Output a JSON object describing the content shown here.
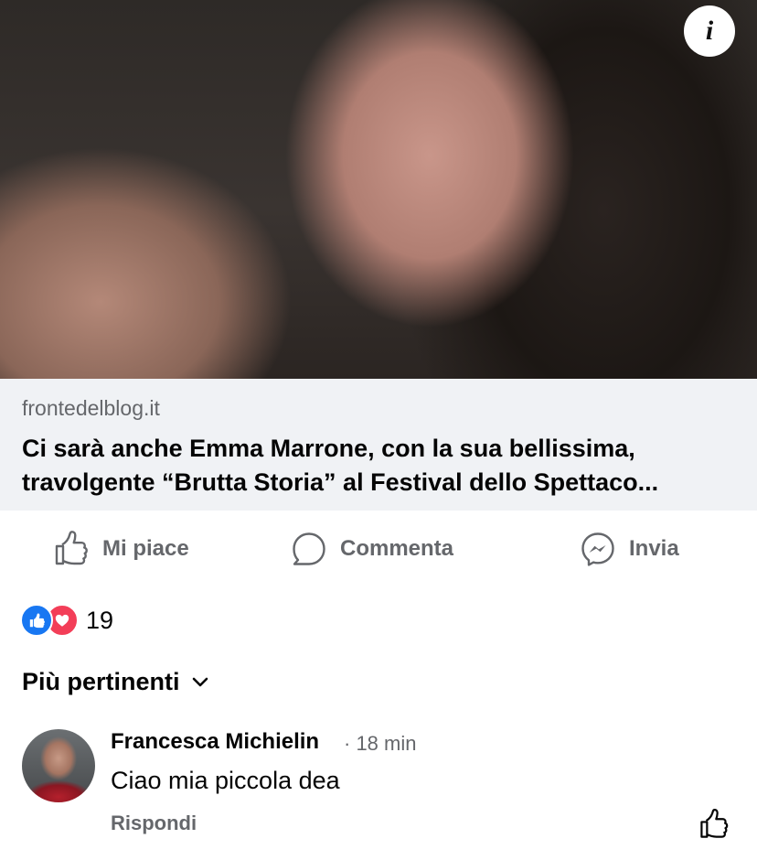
{
  "post": {
    "image_alt": "Foto: ritratto di Emma Marrone",
    "info_icon": "i"
  },
  "link_preview": {
    "domain": "frontedelblog.it",
    "headline_line1": "Ci sarà anche Emma Marrone, con la sua bellissima,",
    "headline_line2": "travolgente “Brutta Storia” al Festival dello Spettaco..."
  },
  "actions": {
    "like_label": "Mi piace",
    "comment_label": "Commenta",
    "send_label": "Invia"
  },
  "reactions": {
    "count": "19",
    "types": [
      "like-icon",
      "love-icon"
    ],
    "like_color": "#1877f2",
    "love_color": "#f33e58"
  },
  "comments": {
    "sort_label": "Più pertinenti",
    "items": [
      {
        "author": "Francesca Michielin",
        "time": "· 18 min",
        "text": "Ciao mia piccola dea",
        "reply_label": "Rispondi"
      }
    ]
  },
  "colors": {
    "link_box_bg": "#f0f2f5",
    "secondary_text": "#65676b"
  }
}
